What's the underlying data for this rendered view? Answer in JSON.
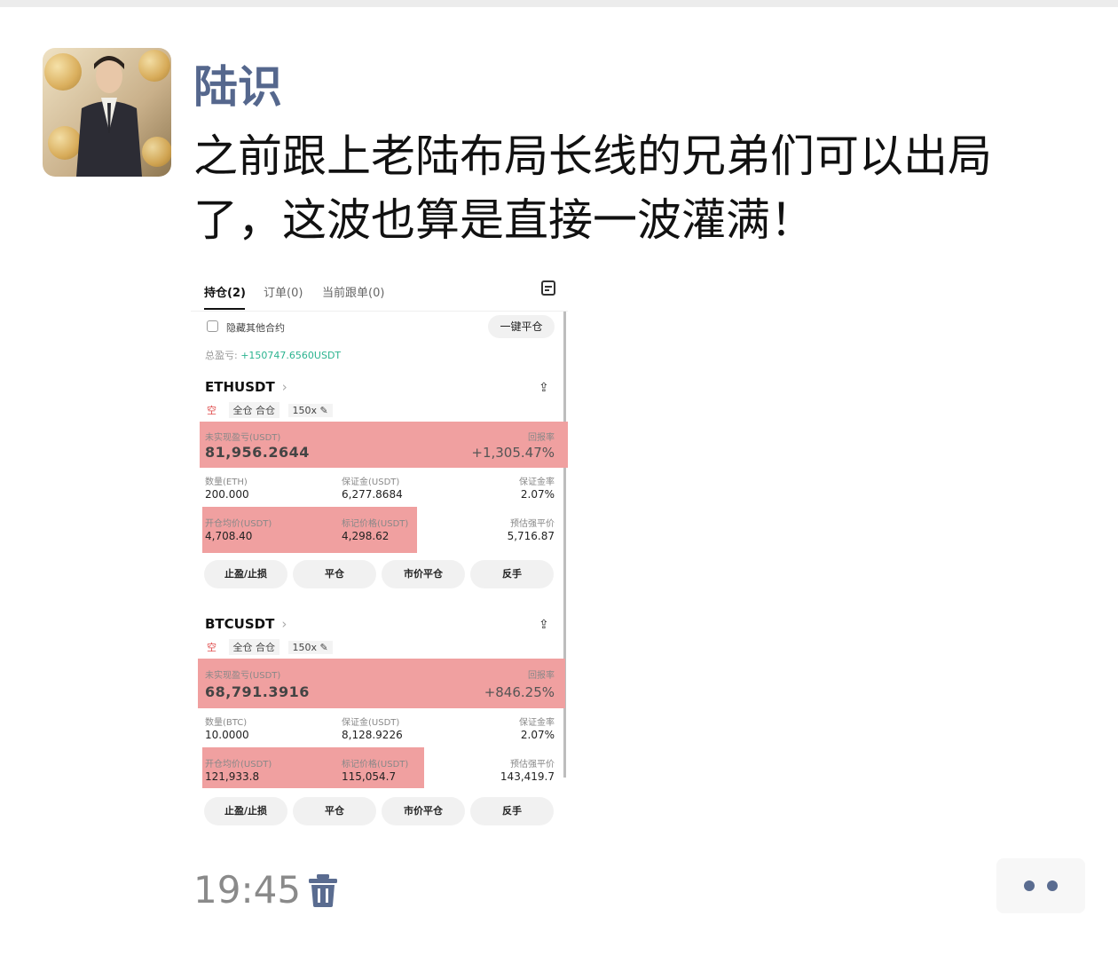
{
  "chat": {
    "author": "陆识",
    "message": "之前跟上老陆布局长线的兄弟们可以出局了，这波也算是直接一波灌满！",
    "time": "19:45"
  },
  "screenshot": {
    "tabs": [
      {
        "label": "持仓(2)",
        "active": true
      },
      {
        "label": "订单(0)",
        "active": false
      },
      {
        "label": "当前跟单(0)",
        "active": false
      }
    ],
    "hide_other_contracts": "隐藏其他合约",
    "close_all_button": "一键平仓",
    "total_pnl_label": "总盈亏:",
    "total_pnl_value": "+150747.6560USDT",
    "positions": [
      {
        "symbol": "ETHUSDT",
        "side": "空",
        "margin_mode": "全仓 合仓",
        "leverage": "150x",
        "unrealized_label": "未实现盈亏(USDT)",
        "unrealized_value": "81,956.2644",
        "roe_label": "回报率",
        "roe_value": "+1,305.47%",
        "qty_label": "数量(ETH)",
        "qty_value": "200.000",
        "margin_label": "保证金(USDT)",
        "margin_value": "6,277.8684",
        "margin_ratio_label": "保证金率",
        "margin_ratio_value": "2.07%",
        "entry_label": "开仓均价(USDT)",
        "entry_value": "4,708.40",
        "mark_label": "标记价格(USDT)",
        "mark_value": "4,298.62",
        "liq_label": "预估强平价",
        "liq_value": "5,716.87"
      },
      {
        "symbol": "BTCUSDT",
        "side": "空",
        "margin_mode": "全仓 合仓",
        "leverage": "150x",
        "unrealized_label": "未实现盈亏(USDT)",
        "unrealized_value": "68,791.3916",
        "roe_label": "回报率",
        "roe_value": "+846.25%",
        "qty_label": "数量(BTC)",
        "qty_value": "10.0000",
        "margin_label": "保证金(USDT)",
        "margin_value": "8,128.9226",
        "margin_ratio_label": "保证金率",
        "margin_ratio_value": "2.07%",
        "entry_label": "开仓均价(USDT)",
        "entry_value": "121,933.8",
        "mark_label": "标记价格(USDT)",
        "mark_value": "115,054.7",
        "liq_label": "预估强平价",
        "liq_value": "143,419.7"
      }
    ],
    "action_buttons": [
      "止盈/止损",
      "平仓",
      "市价平仓",
      "反手"
    ]
  },
  "colors": {
    "author_name": "#55678d",
    "highlight": "#f0a0a0",
    "profit_green": "#2bb38f",
    "short_red": "#e04f4f"
  },
  "icons": [
    "doc-icon",
    "share-icon",
    "trash-icon",
    "more-icon"
  ]
}
